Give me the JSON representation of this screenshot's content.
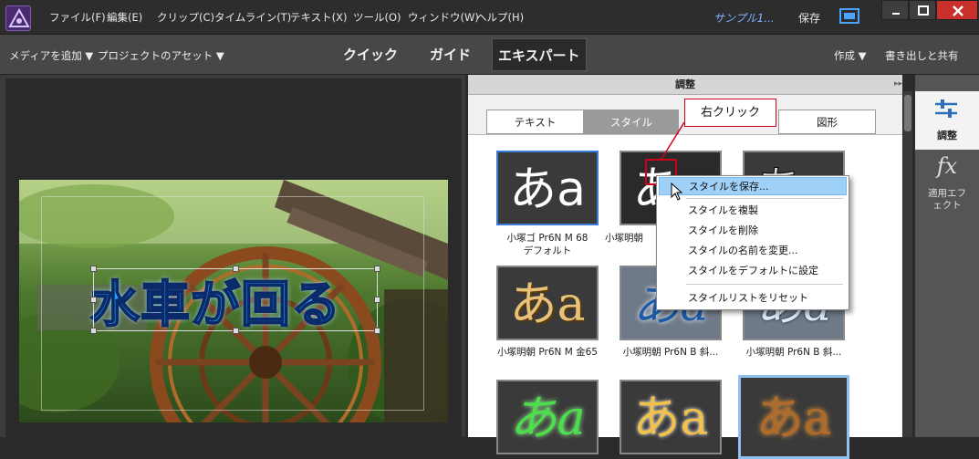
{
  "menubar": {
    "items": [
      "ファイル(F)",
      "編集(E)",
      "クリップ(C)",
      "タイムライン(T)",
      "テキスト(X)",
      "ツール(O)",
      "ウィンドウ(W)",
      "ヘルプ(H)"
    ],
    "project_name": "サンプル1...",
    "save_label": "保存"
  },
  "toolbar": {
    "add_media": "メディアを追加",
    "project_assets": "プロジェクトのアセット",
    "modes": [
      "クイック",
      "ガイド",
      "エキスパート"
    ],
    "create": "作成",
    "export_share": "書き出しと共有"
  },
  "monitor": {
    "title_text": "水車が回る"
  },
  "panel": {
    "title": "調整",
    "tabs": [
      "テキスト",
      "スタイル",
      "図形"
    ],
    "styles": [
      {
        "glyph": "あa",
        "label": "小塚ゴ Pr6N M 68",
        "label2": "デフォルト"
      },
      {
        "glyph": "あa",
        "label": "小塚明朝",
        "label2": ""
      },
      {
        "glyph": "あa",
        "label": "",
        "label2": ""
      },
      {
        "glyph": "あa",
        "label": "小塚明朝 Pr6N M 金65",
        "label2": ""
      },
      {
        "glyph": "あa",
        "label": "小塚明朝 Pr6N B 斜...",
        "label2": ""
      },
      {
        "glyph": "あa",
        "label": "小塚明朝 Pr6N B 斜...",
        "label2": ""
      },
      {
        "glyph": "あa",
        "label": "",
        "label2": ""
      },
      {
        "glyph": "あa",
        "label": "",
        "label2": ""
      },
      {
        "glyph": "あa",
        "label": "",
        "label2": ""
      }
    ]
  },
  "sidebar": {
    "adjust_label": "調整",
    "fx_glyph": "fx",
    "applied_effects_label": "適用エフェクト"
  },
  "context_menu": {
    "items": [
      "スタイルを保存...",
      "スタイルを複製",
      "スタイルを削除",
      "スタイルの名前を変更...",
      "スタイルをデフォルトに設定",
      "スタイルリストをリセット"
    ],
    "highlighted": "スタイルを保存..."
  },
  "annotation": {
    "callout": "右クリック"
  },
  "colors": {
    "accent_red": "#d0021b",
    "highlight": "#9fd0f8",
    "title_blue": "#29a8ff",
    "project_name": "#7fb0ff"
  }
}
